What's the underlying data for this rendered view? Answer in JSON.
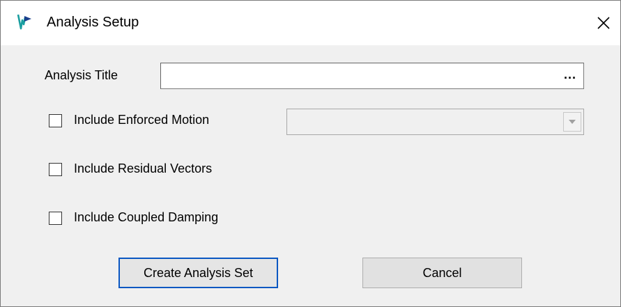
{
  "window": {
    "title": "Analysis Setup",
    "app_icon": "waveform-app-icon",
    "close_icon": "close-icon"
  },
  "form": {
    "analysis_title_label": "Analysis Title",
    "analysis_title_value": "",
    "browse_label": "...",
    "enforced_motion_label": "Include Enforced Motion",
    "enforced_motion_checked": false,
    "enforced_motion_select_value": "",
    "residual_vectors_label": "Include Residual Vectors",
    "residual_vectors_checked": false,
    "coupled_damping_label": "Include Coupled Damping",
    "coupled_damping_checked": false
  },
  "buttons": {
    "create_label": "Create Analysis Set",
    "cancel_label": "Cancel"
  },
  "colors": {
    "accent": "#0a57c2",
    "icon_teal": "#1a9ea0"
  }
}
